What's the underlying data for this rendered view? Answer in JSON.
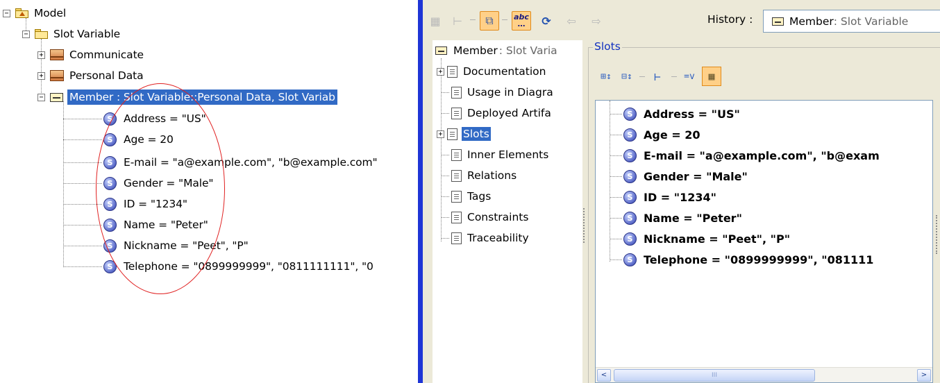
{
  "left_tree": {
    "root": {
      "label": "Model"
    },
    "package": {
      "label": "Slot Variable"
    },
    "classes": [
      {
        "label": "Communicate"
      },
      {
        "label": "Personal Data"
      }
    ],
    "instance": {
      "label": "Member : Slot Variable::Personal Data, Slot Variab"
    },
    "slots": [
      {
        "label": "Address = \"US\""
      },
      {
        "label": "Age = 20"
      },
      {
        "label": "E-mail = \"a@example.com\", \"b@example.com\""
      },
      {
        "label": "Gender = \"Male\""
      },
      {
        "label": "ID = \"1234\""
      },
      {
        "label": "Name = \"Peter\""
      },
      {
        "label": "Nickname = \"Peet\", \"P\""
      },
      {
        "label": "Telephone = \"0899999999\", \"0811111111\", \"0"
      }
    ],
    "highlight_color": "#316ac5",
    "annotation_color": "#e02020"
  },
  "splitter_color": "#1f35d6",
  "toolbar": {
    "buttons": [
      {
        "icon": "grid-view-icon",
        "glyph": "▦"
      },
      {
        "icon": "hierarchy-view-icon",
        "glyph": "⧉"
      },
      {
        "icon": "copy-view-icon",
        "glyph": "⧉"
      },
      {
        "icon": "abc-text-icon",
        "glyph": "abc\n…"
      },
      {
        "icon": "refresh-icon",
        "glyph": "⟳"
      },
      {
        "icon": "back-arrow-icon",
        "glyph": "⇦"
      },
      {
        "icon": "forward-arrow-icon",
        "glyph": "⇨"
      }
    ],
    "history_label": "History :",
    "history_value_main": "Member",
    "history_value_rest": " : Slot Variable"
  },
  "nav": {
    "root_main": "Member",
    "root_rest": " : Slot Varia",
    "items": [
      {
        "label": "Documentation",
        "expandable": true
      },
      {
        "label": "Usage in Diagra",
        "expandable": false
      },
      {
        "label": "Deployed Artifa",
        "expandable": false
      },
      {
        "label": "Slots",
        "expandable": true,
        "selected": true
      },
      {
        "label": "Inner Elements",
        "expandable": false
      },
      {
        "label": "Relations",
        "expandable": false
      },
      {
        "label": "Tags",
        "expandable": false
      },
      {
        "label": "Constraints",
        "expandable": false
      },
      {
        "label": "Traceability",
        "expandable": false
      }
    ]
  },
  "slots_panel": {
    "title": "Slots",
    "tools": [
      {
        "icon": "expand-slots-icon",
        "glyph": "⊞⇕"
      },
      {
        "icon": "collapse-slots-icon",
        "glyph": "⊟⇕"
      },
      {
        "icon": "tree-structure-icon",
        "glyph": "⊢"
      },
      {
        "icon": "show-value-icon",
        "glyph": "=v"
      },
      {
        "icon": "grid-layout-icon",
        "glyph": "▦"
      }
    ],
    "slots": [
      {
        "label": "Address = \"US\""
      },
      {
        "label": "Age = 20"
      },
      {
        "label": "E-mail = \"a@example.com\", \"b@exam"
      },
      {
        "label": "Gender = \"Male\""
      },
      {
        "label": "ID = \"1234\""
      },
      {
        "label": "Name = \"Peter\""
      },
      {
        "label": "Nickname = \"Peet\", \"P\""
      },
      {
        "label": "Telephone = \"0899999999\", \"081111"
      }
    ],
    "scroll": {
      "left": "<",
      "right": ">",
      "thumb": "III"
    }
  }
}
